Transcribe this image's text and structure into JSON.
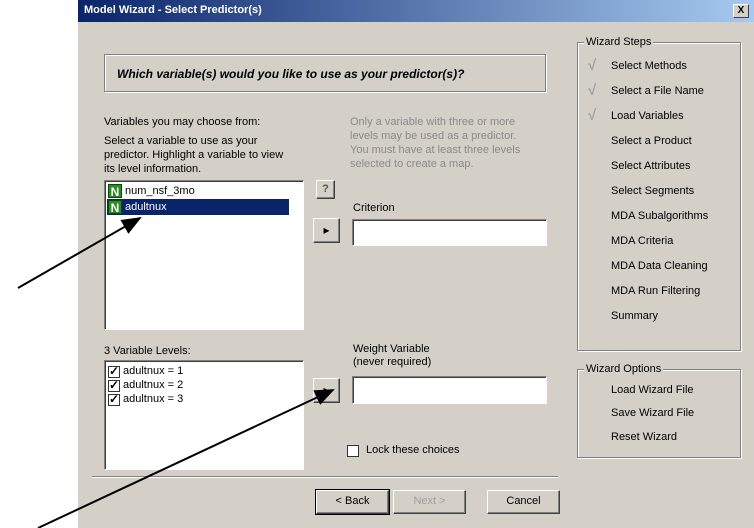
{
  "window": {
    "title": "Model Wizard - Select Predictor(s)",
    "close_glyph": "X"
  },
  "question": "Which variable(s) would you like to use as your predictor(s)?",
  "variables_section": {
    "heading": "Variables you may choose from:",
    "instructions": [
      "Select a variable to use as your",
      "predictor.  Highlight a variable to view",
      "its level information."
    ],
    "items": [
      {
        "icon": "N",
        "name": "num_nsf_3mo",
        "selected": false
      },
      {
        "icon": "N",
        "name": "adultnux",
        "selected": true
      }
    ]
  },
  "info_note": [
    "Only a variable with three or more",
    "levels may be used as a predictor.",
    "You must have at least three levels",
    "selected to create a map."
  ],
  "help_button": "?",
  "criterion": {
    "label": "Criterion",
    "value": "",
    "move_glyph": "▸"
  },
  "levels_section": {
    "heading": "3 Variable Levels:",
    "items": [
      {
        "label": "adultnux = 1",
        "checked": true
      },
      {
        "label": "adultnux = 2",
        "checked": true
      },
      {
        "label": "adultnux = 3",
        "checked": true
      }
    ]
  },
  "weight": {
    "label_line1": "Weight Variable",
    "label_line2": "(never required)",
    "value": "",
    "move_glyph": "▸"
  },
  "lock_choices": {
    "label": "Lock these choices",
    "checked": false
  },
  "buttons": {
    "back": "< Back",
    "next": "Next >",
    "cancel": "Cancel"
  },
  "wizard_steps": {
    "title": "Wizard Steps",
    "items": [
      {
        "label": "Select Methods",
        "done": true
      },
      {
        "label": "Select a File Name",
        "done": true
      },
      {
        "label": "Load Variables",
        "done": true
      },
      {
        "label": "Select a Product",
        "done": false
      },
      {
        "label": "Select Attributes",
        "done": false
      },
      {
        "label": "Select Segments",
        "done": false
      },
      {
        "label": "MDA Subalgorithms",
        "done": false
      },
      {
        "label": "MDA Criteria",
        "done": false
      },
      {
        "label": "MDA Data Cleaning",
        "done": false
      },
      {
        "label": "MDA Run Filtering",
        "done": false
      },
      {
        "label": "Summary",
        "done": false
      }
    ]
  },
  "wizard_options": {
    "title": "Wizard Options",
    "items": [
      "Load Wizard File",
      "Save Wizard File",
      "Reset Wizard"
    ]
  },
  "check_glyph": "√"
}
